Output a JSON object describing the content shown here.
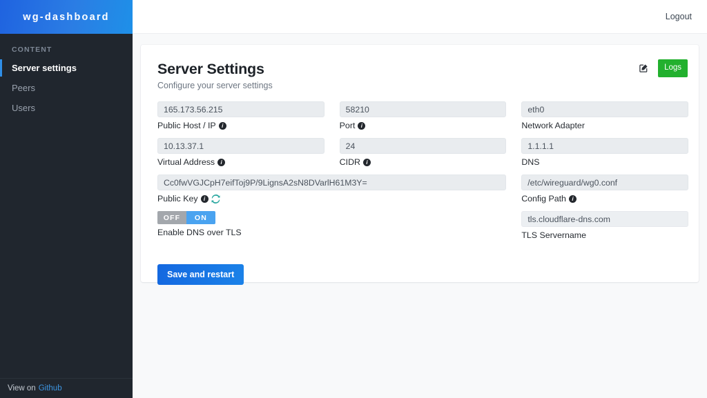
{
  "brand": {
    "title": "wg-dashboard"
  },
  "sidebar": {
    "section_label": "CONTENT",
    "items": [
      {
        "label": "Server settings",
        "active": true
      },
      {
        "label": "Peers",
        "active": false
      },
      {
        "label": "Users",
        "active": false
      }
    ],
    "footer": {
      "prefix": "View on",
      "link_label": "Github"
    }
  },
  "topbar": {
    "logout_label": "Logout"
  },
  "card": {
    "title": "Server Settings",
    "subtitle": "Configure your server settings",
    "edit_icon": "edit-pencil-square-icon",
    "logs_label": "Logs",
    "logs_color": "#22b02e",
    "fields": [
      {
        "name": "public-host-ip",
        "value": "165.173.56.215",
        "label": "Public Host / IP",
        "info": true
      },
      {
        "name": "port",
        "value": "58210",
        "label": "Port",
        "info": true
      },
      {
        "name": "network-adapter",
        "value": "eth0",
        "label": "Network Adapter",
        "info": false
      },
      {
        "name": "virtual-address",
        "value": "10.13.37.1",
        "label": "Virtual Address",
        "info": true
      },
      {
        "name": "cidr",
        "value": "24",
        "label": "CIDR",
        "info": true
      },
      {
        "name": "dns",
        "value": "1.1.1.1",
        "label": "DNS",
        "info": false
      },
      {
        "name": "public-key",
        "value": "Cc0fwVGJCpH7eifToj9P/9LignsA2sN8DVarlH61M3Y=",
        "label": "Public Key",
        "info": true,
        "refresh": true
      },
      {
        "name": "config-path",
        "value": "/etc/wireguard/wg0.conf",
        "label": "Config Path",
        "info": true
      },
      {
        "name": "tls-servername",
        "value": "tls.cloudflare-dns.com",
        "label": "TLS Servername",
        "info": false
      }
    ],
    "dns_over_tls": {
      "off_label": "OFF",
      "on_label": "ON",
      "label": "Enable DNS over TLS",
      "state": "ON"
    },
    "save_label": "Save and restart"
  },
  "colors": {
    "brand_blue": "#1f63e0",
    "sidebar_dark": "#20262e",
    "accent_blue": "#2f8fe8",
    "logs_green": "#22b02e",
    "refresh_teal": "#2aa7a0"
  }
}
